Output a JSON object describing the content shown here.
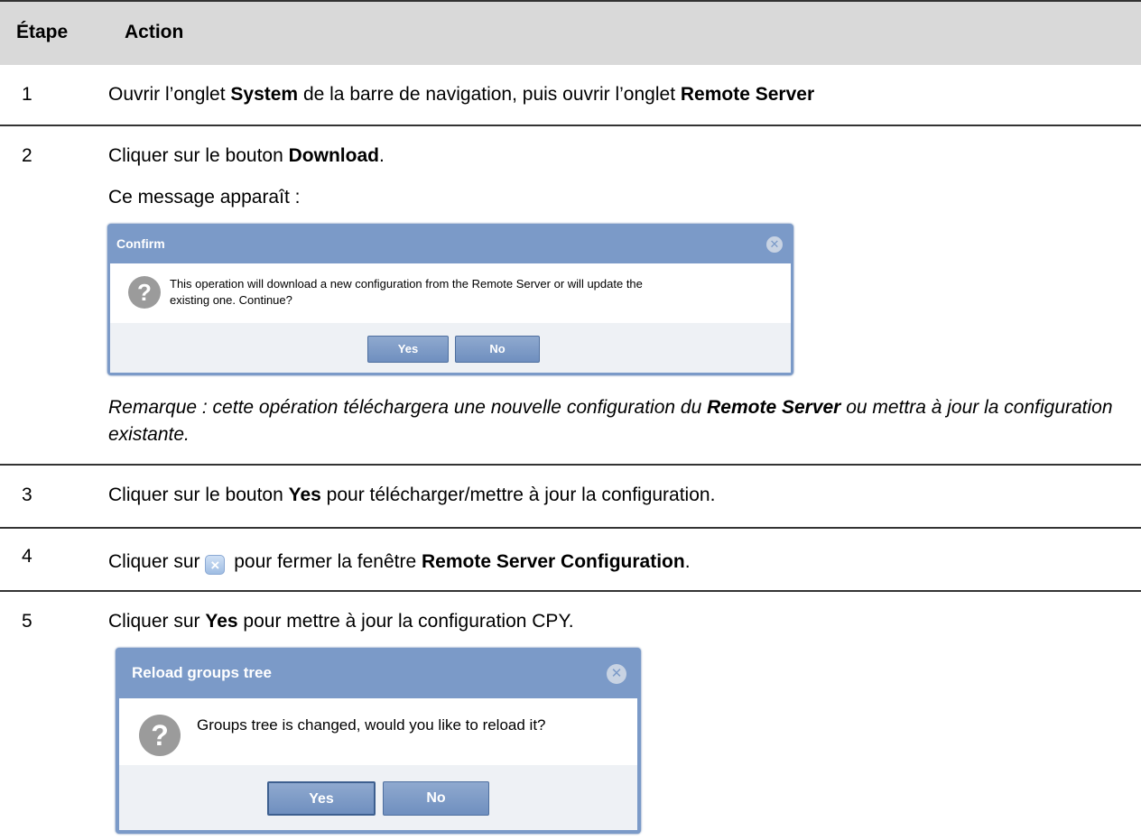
{
  "header": {
    "step": "Étape",
    "action": "Action"
  },
  "rows": [
    {
      "num": "1",
      "text_a": "Ouvrir l’onglet ",
      "bold_a": "System",
      "text_b": " de la barre de navigation, puis ouvrir l’onglet ",
      "bold_b": "Remote Server"
    },
    {
      "num": "2",
      "text_a": "Cliquer sur le bouton ",
      "bold_a": "Download",
      "text_b": ".",
      "message": "Ce message apparaît :",
      "note_a": "Remarque : cette opération téléchargera une nouvelle configuration du ",
      "note_bold": "Remote Server",
      "note_b": " ou mettra à jour la configuration existante."
    },
    {
      "num": "3",
      "text_a": "Cliquer sur le bouton ",
      "bold_a": "Yes",
      "text_b": " pour télécharger/mettre à jour la configuration."
    },
    {
      "num": "4",
      "text_a": "Cliquer sur ",
      "text_b": " pour fermer la fenêtre ",
      "bold_a": "Remote Server Configuration",
      "text_c": "."
    },
    {
      "num": "5",
      "text_a": "Cliquer sur ",
      "bold_a": "Yes",
      "text_b": " pour mettre à jour la configuration CPY."
    }
  ],
  "dialog_confirm": {
    "title": "Confirm",
    "message_line1": "This operation will download a new configuration from the Remote Server or will update the",
    "message_line2": "existing one. Continue?",
    "yes": "Yes",
    "no": "No"
  },
  "dialog_reload": {
    "title": "Reload groups tree",
    "message": "Groups tree is changed, would you like to reload it?",
    "yes": "Yes",
    "no": "No"
  },
  "icons": {
    "close": "close-icon",
    "question": "question-icon"
  },
  "colors": {
    "dialog_header": "#7b9ac8",
    "header_bg": "#d9d9d9"
  }
}
